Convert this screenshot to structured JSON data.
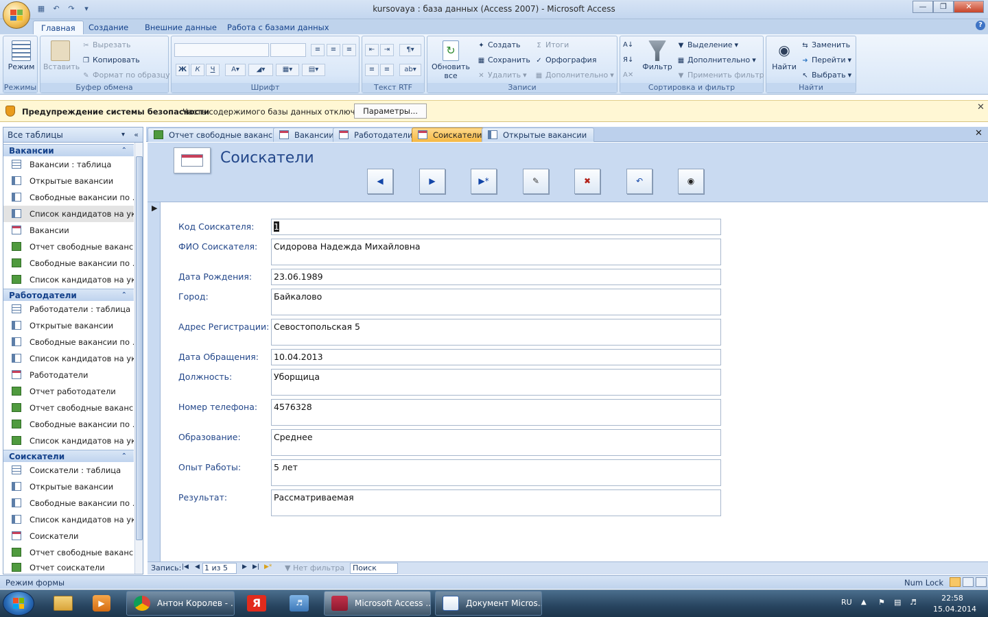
{
  "window": {
    "title": "kursovaya : база данных (Access 2007) - Microsoft Access"
  },
  "ribbon": {
    "tabs": [
      "Главная",
      "Создание",
      "Внешние данные",
      "Работа с базами данных"
    ],
    "groups": {
      "modes": {
        "label": "Режимы",
        "view": "Режим"
      },
      "clipboard": {
        "label": "Буфер обмена",
        "paste": "Вставить",
        "cut": "Вырезать",
        "copy": "Копировать",
        "format_painter": "Формат по образцу"
      },
      "font": {
        "label": "Шрифт"
      },
      "rtf": {
        "label": "Текст RTF"
      },
      "records": {
        "label": "Записи",
        "refresh": "Обновить",
        "refresh2": "все",
        "new": "Создать",
        "save": "Сохранить",
        "delete": "Удалить",
        "totals": "Итоги",
        "spelling": "Орфография",
        "more": "Дополнительно"
      },
      "sort": {
        "label": "Сортировка и фильтр",
        "filter": "Фильтр",
        "selection": "Выделение",
        "advanced": "Дополнительно",
        "toggle": "Применить фильтр"
      },
      "find": {
        "label": "Найти",
        "find": "Найти",
        "replace": "Заменить",
        "goto": "Перейти",
        "select": "Выбрать"
      }
    }
  },
  "security": {
    "title": "Предупреждение системы безопасности",
    "message": "Часть содержимого базы данных отключено",
    "button": "Параметры..."
  },
  "nav": {
    "header": "Все таблицы",
    "groups": [
      {
        "title": "Вакансии",
        "items": [
          {
            "label": "Вакансии : таблица",
            "icon": "table-icon"
          },
          {
            "label": "Открытые вакансии",
            "icon": "query-icon"
          },
          {
            "label": "Свободные вакансии по ...",
            "icon": "query-icon"
          },
          {
            "label": "Список кандидатов на ук...",
            "icon": "query-icon"
          },
          {
            "label": "Вакансии",
            "icon": "form-icon"
          },
          {
            "label": "Отчет свободные ваканс...",
            "icon": "report-icon"
          },
          {
            "label": "Свободные вакансии по ...",
            "icon": "report-icon"
          },
          {
            "label": "Список кандидатов на ук...",
            "icon": "report-icon"
          }
        ]
      },
      {
        "title": "Работодатели",
        "items": [
          {
            "label": "Работодатели : таблица",
            "icon": "table-icon"
          },
          {
            "label": "Открытые вакансии",
            "icon": "query-icon"
          },
          {
            "label": "Свободные вакансии по ...",
            "icon": "query-icon"
          },
          {
            "label": "Список кандидатов на ук...",
            "icon": "query-icon"
          },
          {
            "label": "Работодатели",
            "icon": "form-icon"
          },
          {
            "label": "Отчет работодатели",
            "icon": "report-icon"
          },
          {
            "label": "Отчет свободные ваканс...",
            "icon": "report-icon"
          },
          {
            "label": "Свободные вакансии по ...",
            "icon": "report-icon"
          },
          {
            "label": "Список кандидатов на ук...",
            "icon": "report-icon"
          }
        ]
      },
      {
        "title": "Соискатели",
        "items": [
          {
            "label": "Соискатели : таблица",
            "icon": "table-icon"
          },
          {
            "label": "Открытые вакансии",
            "icon": "query-icon"
          },
          {
            "label": "Свободные вакансии по ...",
            "icon": "query-icon"
          },
          {
            "label": "Список кандидатов на ук...",
            "icon": "query-icon"
          },
          {
            "label": "Соискатели",
            "icon": "form-icon"
          },
          {
            "label": "Отчет свободные ваканс...",
            "icon": "report-icon"
          },
          {
            "label": "Отчет соискатели",
            "icon": "report-icon"
          }
        ]
      }
    ]
  },
  "doctabs": [
    {
      "label": "Отчет свободные вакансии",
      "icon": "report-icon"
    },
    {
      "label": "Вакансии",
      "icon": "form-icon"
    },
    {
      "label": "Работодатели",
      "icon": "form-icon"
    },
    {
      "label": "Соискатели",
      "icon": "form-icon",
      "active": true
    },
    {
      "label": "Открытые вакансии",
      "icon": "query-icon"
    }
  ],
  "form": {
    "title": "Соискатели",
    "fields": [
      {
        "label": "Код Соискателя:",
        "value": "1"
      },
      {
        "label": "ФИО Соискателя:",
        "value": "Сидорова Надежда Михайловна"
      },
      {
        "label": "Дата Рождения:",
        "value": "23.06.1989"
      },
      {
        "label": "Город:",
        "value": "Байкалово"
      },
      {
        "label": "Адрес Регистрации:",
        "value": "Севостопольская 5"
      },
      {
        "label": "Дата Обращения:",
        "value": "10.04.2013"
      },
      {
        "label": "Должность:",
        "value": "Уборщица"
      },
      {
        "label": "Номер телефона:",
        "value": "4576328"
      },
      {
        "label": "Образование:",
        "value": "Среднее"
      },
      {
        "label": "Опыт Работы:",
        "value": "5 лет"
      },
      {
        "label": "Результат:",
        "value": "Рассматриваемая"
      }
    ]
  },
  "recordnav": {
    "label": "Запись:",
    "position": "1 из 5",
    "filter": "Нет фильтра",
    "search": "Поиск"
  },
  "statusbar": {
    "mode": "Режим формы",
    "numlock": "Num Lock"
  },
  "taskbar": {
    "items": [
      "Антон Королев - ...",
      "Microsoft Access ...",
      "Документ Micros..."
    ],
    "lang": "RU",
    "time": "22:58",
    "date": "15.04.2014"
  }
}
